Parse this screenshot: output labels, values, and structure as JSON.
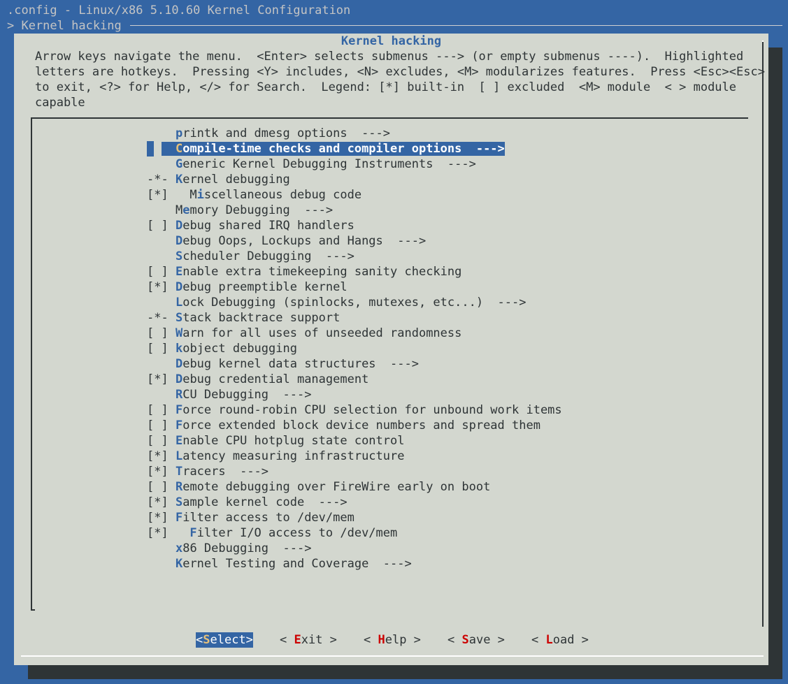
{
  "window": {
    "title": ".config - Linux/x86 5.10.60 Kernel Configuration",
    "breadcrumb": "> Kernel hacking"
  },
  "dialog": {
    "title": "Kernel hacking",
    "help_lines": [
      "Arrow keys navigate the menu.  <Enter> selects submenus ---> (or empty submenus ----).  Highlighted",
      "letters are hotkeys.  Pressing <Y> includes, <N> excludes, <M> modularizes features.  Press <Esc><Esc>",
      "to exit, <?> for Help, </> for Search.  Legend: [*] built-in  [ ] excluded  <M> module  < > module",
      "capable"
    ]
  },
  "menu": {
    "selected_index": 1,
    "items": [
      {
        "prefix": "    ",
        "indent": "",
        "hot": "p",
        "rest": "rintk and dmesg options  --->"
      },
      {
        "prefix": "    ",
        "indent": "",
        "hot": "C",
        "rest": "ompile-time checks and compiler options  --->"
      },
      {
        "prefix": "    ",
        "indent": "",
        "hot": "G",
        "rest": "eneric Kernel Debugging Instruments  --->"
      },
      {
        "prefix": "-*- ",
        "indent": "",
        "hot": "K",
        "rest": "ernel debugging"
      },
      {
        "prefix": "[*] ",
        "indent": "  ",
        "hot": "M",
        "hot_pos": 1,
        "text": "Miscellaneous debug code"
      },
      {
        "prefix": "    ",
        "indent": "",
        "hot": "M",
        "hot_pos": 1,
        "text": "Memory Debugging  --->"
      },
      {
        "prefix": "[ ] ",
        "indent": "",
        "hot": "D",
        "rest": "ebug shared IRQ handlers"
      },
      {
        "prefix": "    ",
        "indent": "",
        "hot": "D",
        "rest": "ebug Oops, Lockups and Hangs  --->"
      },
      {
        "prefix": "    ",
        "indent": "",
        "hot": "S",
        "rest": "cheduler Debugging  --->"
      },
      {
        "prefix": "[ ] ",
        "indent": "",
        "hot": "E",
        "rest": "nable extra timekeeping sanity checking"
      },
      {
        "prefix": "[*] ",
        "indent": "",
        "hot": "D",
        "rest": "ebug preemptible kernel"
      },
      {
        "prefix": "    ",
        "indent": "",
        "hot": "L",
        "rest": "ock Debugging (spinlocks, mutexes, etc...)  --->"
      },
      {
        "prefix": "-*- ",
        "indent": "",
        "hot": "S",
        "rest": "tack backtrace support"
      },
      {
        "prefix": "[ ] ",
        "indent": "",
        "hot": "W",
        "rest": "arn for all uses of unseeded randomness"
      },
      {
        "prefix": "[ ] ",
        "indent": "",
        "hot": "k",
        "rest": "object debugging"
      },
      {
        "prefix": "    ",
        "indent": "",
        "hot": "D",
        "rest": "ebug kernel data structures  --->"
      },
      {
        "prefix": "[*] ",
        "indent": "",
        "hot": "D",
        "rest": "ebug credential management"
      },
      {
        "prefix": "    ",
        "indent": "",
        "hot": "R",
        "rest": "CU Debugging  --->"
      },
      {
        "prefix": "[ ] ",
        "indent": "",
        "hot": "F",
        "rest": "orce round-robin CPU selection for unbound work items"
      },
      {
        "prefix": "[ ] ",
        "indent": "",
        "hot": "F",
        "rest": "orce extended block device numbers and spread them"
      },
      {
        "prefix": "[ ] ",
        "indent": "",
        "hot": "E",
        "rest": "nable CPU hotplug state control"
      },
      {
        "prefix": "[*] ",
        "indent": "",
        "hot": "L",
        "rest": "atency measuring infrastructure"
      },
      {
        "prefix": "[*] ",
        "indent": "",
        "hot": "T",
        "rest": "racers  --->"
      },
      {
        "prefix": "[ ] ",
        "indent": "",
        "hot": "R",
        "rest": "emote debugging over FireWire early on boot"
      },
      {
        "prefix": "[*] ",
        "indent": "",
        "hot": "S",
        "rest": "ample kernel code  --->"
      },
      {
        "prefix": "[*] ",
        "indent": "",
        "hot": "F",
        "rest": "ilter access to /dev/mem"
      },
      {
        "prefix": "[*] ",
        "indent": "  ",
        "hot": "F",
        "rest": "ilter I/O access to /dev/mem"
      },
      {
        "prefix": "    ",
        "indent": "",
        "hot": "x",
        "rest": "86 Debugging  --->"
      },
      {
        "prefix": "    ",
        "indent": "",
        "hot": "K",
        "rest": "ernel Testing and Coverage  --->"
      }
    ]
  },
  "buttons": [
    {
      "name": "select",
      "pre": "<",
      "hot": "S",
      "rest": "elect",
      "post": ">",
      "active": true
    },
    {
      "name": "exit",
      "pre": "< ",
      "hot": "E",
      "rest": "xit",
      "post": " >",
      "active": false
    },
    {
      "name": "help",
      "pre": "< ",
      "hot": "H",
      "rest": "elp",
      "post": " >",
      "active": false
    },
    {
      "name": "save",
      "pre": "< ",
      "hot": "S",
      "rest": "ave",
      "post": " >",
      "active": false
    },
    {
      "name": "load",
      "pre": "< ",
      "hot": "L",
      "rest": "oad",
      "post": " >",
      "active": false
    }
  ]
}
